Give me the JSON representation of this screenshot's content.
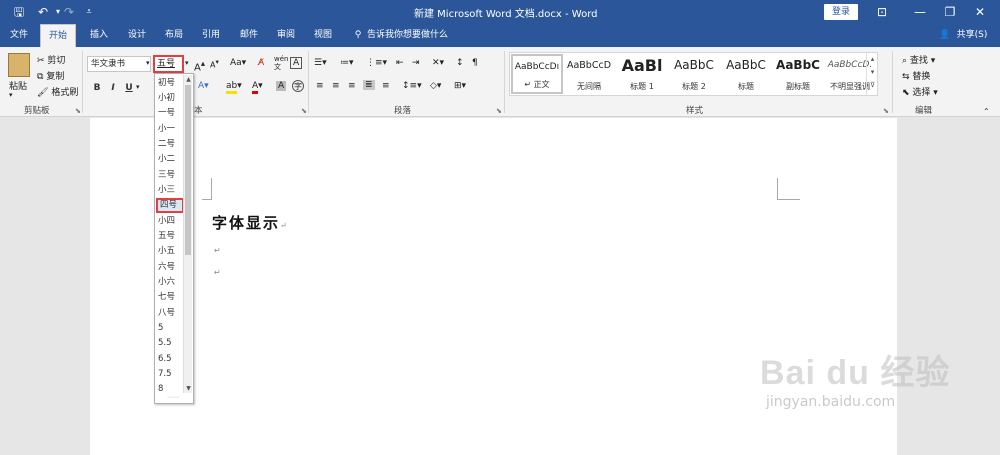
{
  "app": {
    "title": "新建 Microsoft Word 文档.docx - Word",
    "login_label": "登录",
    "share_label": "共享(S)"
  },
  "tabs": [
    "文件",
    "开始",
    "插入",
    "设计",
    "布局",
    "引用",
    "邮件",
    "审阅",
    "视图"
  ],
  "search": {
    "placeholder": "告诉我你想要做什么"
  },
  "clipboard": {
    "paste": "粘贴",
    "cut": "剪切",
    "copy": "复制",
    "format_painter": "格式刷",
    "group": "剪贴板"
  },
  "font": {
    "name": "华文隶书",
    "size": "五号",
    "group_fragment": "本"
  },
  "paragraph": {
    "group": "段落"
  },
  "styles": {
    "group": "样式",
    "items": [
      {
        "sample": "AaBbCcDı",
        "name": "↵ 正文"
      },
      {
        "sample": "AaBbCcD",
        "name": "无间隔"
      },
      {
        "sample": "AaBl",
        "name": "标题 1"
      },
      {
        "sample": "AaBbC",
        "name": "标题 2"
      },
      {
        "sample": "AaBbC",
        "name": "标题"
      },
      {
        "sample": "AaBbC",
        "name": "副标题"
      },
      {
        "sample": "AaBbCcD.",
        "name": "不明显强调"
      }
    ]
  },
  "editing": {
    "find": "查找",
    "replace": "替换",
    "select": "选择",
    "group": "编辑"
  },
  "size_dropdown": {
    "items": [
      "初号",
      "小初",
      "一号",
      "小一",
      "二号",
      "小二",
      "三号",
      "小三",
      "四号",
      "小四",
      "五号",
      "小五",
      "六号",
      "小六",
      "七号",
      "八号",
      "5",
      "5.5",
      "6.5",
      "7.5",
      "8"
    ],
    "highlighted": "四号"
  },
  "document": {
    "text": "字体显示",
    "para_mark": "↵"
  },
  "watermark": {
    "brand": "Bai du 经验",
    "url": "jingyan.baidu.com"
  },
  "colors": {
    "titlebar": "#2b579a",
    "highlight_border": "#e04040"
  }
}
